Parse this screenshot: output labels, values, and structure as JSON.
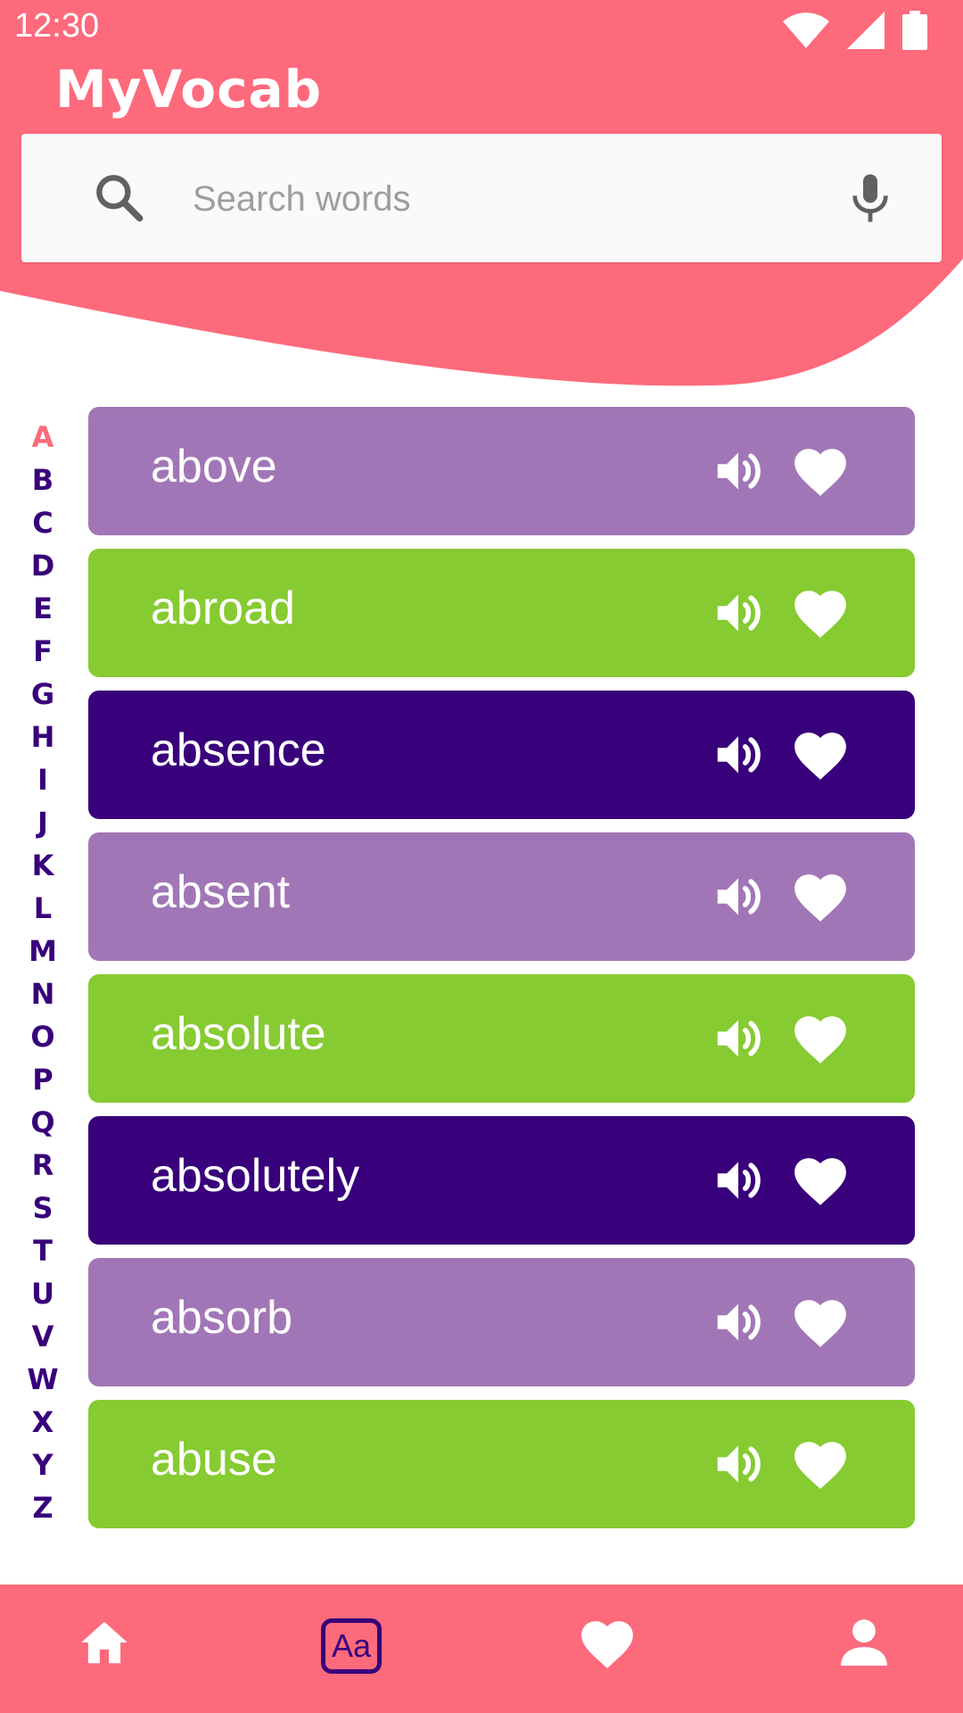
{
  "status_bar": {
    "time": "12:30"
  },
  "app": {
    "title": "MyVocab"
  },
  "search": {
    "placeholder": "Search words",
    "value": ""
  },
  "colors": {
    "primary": "#fd6a7c",
    "accent_dark": "#38007a",
    "card_purple": "#a176b6",
    "card_green": "#86cb32",
    "card_indigo": "#38007a"
  },
  "alphabet": [
    "A",
    "B",
    "C",
    "D",
    "E",
    "F",
    "G",
    "H",
    "I",
    "J",
    "K",
    "L",
    "M",
    "N",
    "O",
    "P",
    "Q",
    "R",
    "S",
    "T",
    "U",
    "V",
    "W",
    "X",
    "Y",
    "Z"
  ],
  "alphabet_active": "A",
  "words": [
    {
      "word": "above",
      "color": "#a176b6"
    },
    {
      "word": "abroad",
      "color": "#86cb32"
    },
    {
      "word": "absence",
      "color": "#38007a"
    },
    {
      "word": "absent",
      "color": "#a176b6"
    },
    {
      "word": "absolute",
      "color": "#86cb32"
    },
    {
      "word": "absolutely",
      "color": "#38007a"
    },
    {
      "word": "absorb",
      "color": "#a176b6"
    },
    {
      "word": "abuse",
      "color": "#86cb32"
    }
  ],
  "bottom_nav": {
    "items": [
      {
        "name": "home",
        "icon": "home-icon"
      },
      {
        "name": "words",
        "icon": "aa-icon",
        "label": "Aa",
        "active": true
      },
      {
        "name": "favorites",
        "icon": "heart-icon"
      },
      {
        "name": "profile",
        "icon": "person-icon"
      }
    ]
  }
}
